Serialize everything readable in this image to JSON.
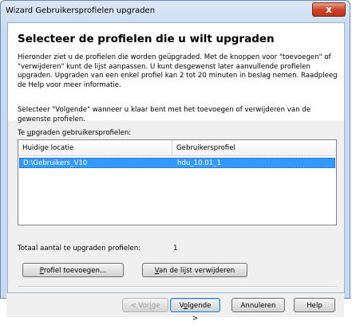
{
  "window": {
    "title": "Wizard Gebruikersprofielen upgraden",
    "close_label": "x"
  },
  "content": {
    "heading": "Selecteer de profielen die u wilt upgraden",
    "description": "Hieronder ziet u de profielen die worden geüpgraded. Met de knoppen voor \"toevoegen\" of \"verwijderen\" kunt de lijst aanpassen. U kunt desgewenst later aanvullende profielen upgraden. Upgraden van een enkel profiel kan 2 tot 20 minuten in beslag nemen. Raadpleeg de Help voor meer informatie.",
    "instruction": "Selecteer \"Volgende\" wanneer u klaar bent met het toevoegen of verwijderen van de gewenste profielen.",
    "list_label_prefix": "Te ",
    "list_label_underlined": "u",
    "list_label_suffix": "pgraden gebruikersprofielen:"
  },
  "table": {
    "columns": [
      "Huidige locatie",
      "Gebruikersprofiel"
    ],
    "rows": [
      {
        "location": "D:\\Gebruikers_V10",
        "profile": "hdu_10.01_1"
      }
    ]
  },
  "totals": {
    "label": "Totaal aantal te upgraden profielen:",
    "count": "1"
  },
  "buttons": {
    "add_u": "P",
    "add_rest": "rofiel toevoegen...",
    "remove_u": "V",
    "remove_rest": "an de lijst verwijderen",
    "prev_pre": "< Vor",
    "prev_u": "i",
    "prev_post": "ge",
    "next_pre": "V",
    "next_u": "o",
    "next_post": "lgende >",
    "cancel": "Annuleren",
    "help": "Help"
  }
}
